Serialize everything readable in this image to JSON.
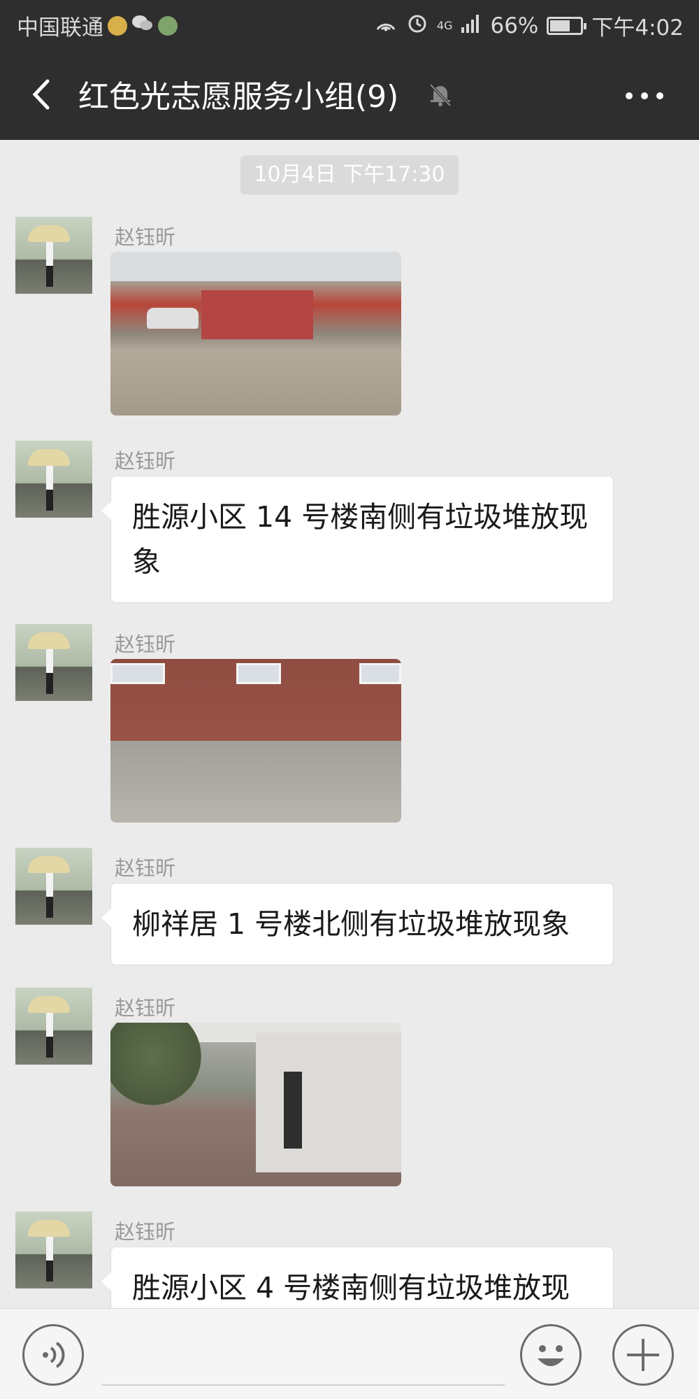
{
  "status_bar": {
    "carrier": "中国联通",
    "battery": "66%",
    "time": "下午4:02",
    "network": "4G",
    "battery_level": 0.66
  },
  "header": {
    "title": "红色光志愿服务小组(9)"
  },
  "chat": {
    "timestamp": "10月4日 下午17:30",
    "messages": [
      {
        "sender": "赵钰昕",
        "type": "image"
      },
      {
        "sender": "赵钰昕",
        "type": "text",
        "text": "胜源小区 14 号楼南侧有垃圾堆放现象"
      },
      {
        "sender": "赵钰昕",
        "type": "image"
      },
      {
        "sender": "赵钰昕",
        "type": "text",
        "text": "柳祥居 1 号楼北侧有垃圾堆放现象"
      },
      {
        "sender": "赵钰昕",
        "type": "image"
      },
      {
        "sender": "赵钰昕",
        "type": "text",
        "text": "胜源小区 4 号楼南侧有垃圾堆放现"
      }
    ]
  },
  "colors": {
    "header_bg": "#2e2e2e",
    "chat_bg": "#ebebeb",
    "bubble_bg": "#ffffff"
  }
}
